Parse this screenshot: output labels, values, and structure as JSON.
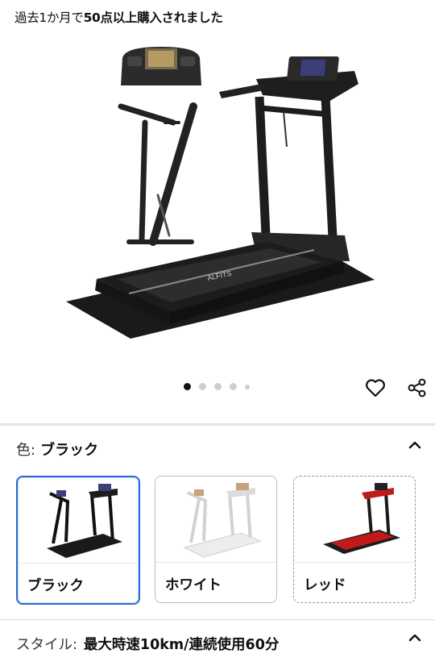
{
  "purchase_note": {
    "prefix": "過去1か月で",
    "bold": "50点以上購入されました"
  },
  "hero": {
    "brand_text": "ALFITS"
  },
  "carousel": {
    "count": 5,
    "active_index": 0
  },
  "variant_color": {
    "label": "色:",
    "value": "ブラック",
    "options": [
      {
        "label": "ブラック",
        "selected": true,
        "color": "#1c1c1c"
      },
      {
        "label": "ホワイト",
        "selected": false,
        "color": "#e8e8e8"
      },
      {
        "label": "レッド",
        "selected": false,
        "color": "#c21a1a"
      }
    ]
  },
  "style": {
    "label": "スタイル:",
    "value": "最大時速10km/連続使用60分"
  }
}
